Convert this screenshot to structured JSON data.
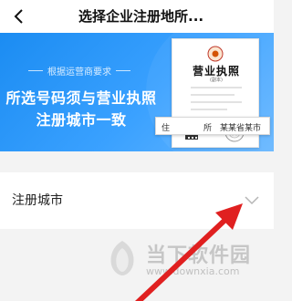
{
  "nav": {
    "title": "选择企业注册地所..."
  },
  "banner": {
    "tagline": "根据运营商要求",
    "headline_line1": "所选号码须与营业执照",
    "headline_line2": "注册城市一致",
    "license": {
      "title": "营业执照",
      "subtitle": "(副本)",
      "address_label_1": "住",
      "address_label_2": "所",
      "address_value": "某某省某市"
    }
  },
  "form": {
    "city_label": "注册城市"
  },
  "watermark": {
    "text": "当下软件园",
    "url": "www.downxia.com"
  },
  "colors": {
    "banner_blue": "#1b8cf2",
    "pointer_red": "#e02020",
    "background": "#f3f3f3"
  },
  "icons": {
    "back": "chevron-left-icon",
    "dropdown": "chevron-down-icon",
    "pointer": "red-arrow-icon"
  }
}
